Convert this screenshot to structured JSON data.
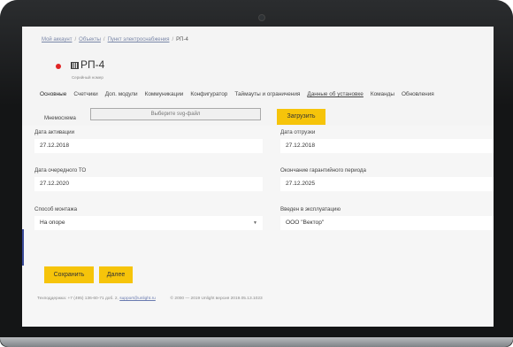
{
  "breadcrumb": {
    "items": [
      "Мой аккаунт",
      "Объекты",
      "Пункт электроснабжения"
    ],
    "current": "РП-4"
  },
  "device": {
    "name": "РП-4",
    "serial_label": "Серийный номер",
    "status_color": "#e02424"
  },
  "tabs": [
    "Основные",
    "Счетчики",
    "Доп. модули",
    "Коммуникации",
    "Конфигуратор",
    "Таймауты и ограничения",
    "Данные об установке",
    "Команды",
    "Обновления"
  ],
  "file": {
    "label": "Мнемосхема",
    "placeholder": "Выберите svg-файл",
    "upload_label": "Загрузить"
  },
  "fields": {
    "activation": {
      "label": "Дата активации",
      "value": "27.12.2018"
    },
    "shipment": {
      "label": "Дата отгрузки",
      "value": "27.12.2018"
    },
    "next_service": {
      "label": "Дата очередного ТО",
      "value": "27.12.2020"
    },
    "warranty_end": {
      "label": "Окончание гарантийного периода",
      "value": "27.12.2025"
    },
    "mounting": {
      "label": "Способ монтажа",
      "value": "На опоре"
    },
    "commissioned": {
      "label": "Введен в эксплуатацию",
      "value": "ООО \"Вектор\""
    }
  },
  "actions": {
    "save": "Сохранить",
    "next": "Далее"
  },
  "footer": {
    "support_text": "Техподдержка: +7 (495) 136-60-71 доб. 2,",
    "support_email": "support@unlight.ru",
    "copyright": "© 2000 — 2019 Unlight версия 2019.05.13.1023"
  },
  "colors": {
    "accent": "#f6c40a",
    "frame": "#141516"
  }
}
